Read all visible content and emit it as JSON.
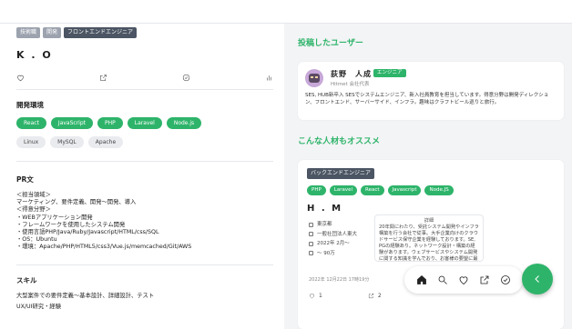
{
  "profile": {
    "tags": [
      "技術職",
      "開発",
      "フロントエンドエンジニア"
    ],
    "name": "K . O",
    "env_title": "開発環境",
    "env_primary": [
      "React",
      "JavaScript",
      "PHP",
      "Laravel",
      "Node.js"
    ],
    "env_secondary": [
      "Linux",
      "MySQL",
      "Apache"
    ],
    "pr_title": "PR文",
    "pr_body": "＜担当領域＞\nマーケティング、要件定義、開発〜開発、導入\n＜得意分野＞\n・WEBアプリケーション開発\n・フレームワークを使用したシステム開発\n・使用言語PHP/Java/Ruby/Javascript/HTML/css/SQL\n・OS：Ubuntu\n・環境：Apache/PHP/HTML5/css3/Vue.js/memcached/Git/AWS",
    "skill_title": "スキル",
    "skills": [
      "大型案件での要件定義〜基本設計、詳細設計、テスト",
      "UX/UI研究・経験"
    ]
  },
  "posted_heading": "投稿したユーザー",
  "poster": {
    "name": "荻野　人成",
    "badge": "エンジニア",
    "company": "Hitmet 会社代表",
    "desc": "SES, HUB新卒入 SESでシステムエンジニア、新入社員教育を担当しています。得意分野は開発ディレクション、フロントエンド、サーバーサイド、インフラ。趣味はクラフトビール巡りと旅行。"
  },
  "recommend_heading": "こんな人材もオススメ",
  "recommend": {
    "tag": "バックエンドエンジニア",
    "pills": [
      "PHP",
      "Laravel",
      "React",
      "Javascript",
      "Node.JS"
    ],
    "name": "H . M",
    "info": [
      "東京都",
      "一般社団法人東大",
      "2022年 2月〜",
      "〜 90万"
    ],
    "bubble_title": "詳細",
    "bubble_text": "20年間にわたり、受託システム開発やインフラ構築を行う会社で従事。大手企業向けのクラウドサービス保守企業を経験しております。SE, PGの経験あり。ネットワーク設計・構築の経験があります。ウェブサービスやシステム開発に関する知識を学んでおり、お客様の要望に最適なシステムにつなげます。",
    "stamp": "2022年 12月22日 17時19分",
    "likes": "1",
    "shares": "2"
  },
  "icons": {
    "actions": [
      "heart-icon",
      "share-icon",
      "check-circle-icon",
      "bar-chart-icon"
    ],
    "toolbar": [
      "home-icon",
      "search-icon",
      "heart-icon",
      "share-icon",
      "check-circle-icon"
    ],
    "fab": "chevron-left-icon"
  },
  "colors": {
    "accent": "#2eb46a",
    "tag_gray": "#9ca3af",
    "tag_navy": "#4b5563"
  }
}
